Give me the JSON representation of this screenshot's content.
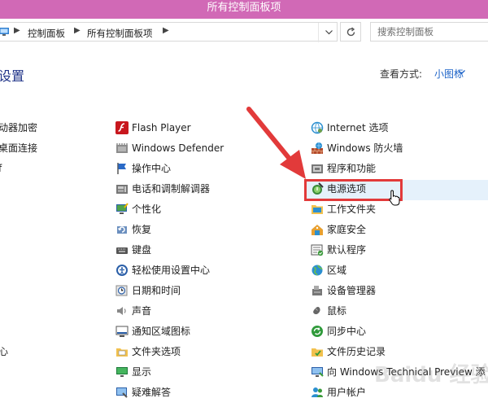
{
  "window": {
    "title": "所有控制面板项"
  },
  "address": {
    "crumbs": [
      "控制面板",
      "所有控制面板项"
    ],
    "search_placeholder": "搜索控制面板"
  },
  "heading": "设置",
  "view": {
    "label": "查看方式:",
    "mode": "小图标"
  },
  "col1": [
    {
      "label": "动器加密"
    },
    {
      "label": "桌面连接"
    },
    {
      "label": "f"
    },
    {
      "label": "心"
    }
  ],
  "col2": [
    {
      "label": "Flash Player",
      "icon": "flash-icon"
    },
    {
      "label": "Windows Defender",
      "icon": "defender-icon"
    },
    {
      "label": "操作中心",
      "icon": "flag-icon"
    },
    {
      "label": "电话和调制解调器",
      "icon": "phone-modem-icon"
    },
    {
      "label": "个性化",
      "icon": "personalization-icon"
    },
    {
      "label": "恢复",
      "icon": "recovery-icon"
    },
    {
      "label": "键盘",
      "icon": "keyboard-icon"
    },
    {
      "label": "轻松使用设置中心",
      "icon": "ease-of-access-icon"
    },
    {
      "label": "日期和时间",
      "icon": "clock-icon"
    },
    {
      "label": "声音",
      "icon": "speaker-icon"
    },
    {
      "label": "通知区域图标",
      "icon": "notification-icon"
    },
    {
      "label": "文件夹选项",
      "icon": "folder-options-icon"
    },
    {
      "label": "显示",
      "icon": "display-icon"
    },
    {
      "label": "疑难解答",
      "icon": "troubleshoot-icon"
    }
  ],
  "col3": [
    {
      "label": "Internet 选项",
      "icon": "internet-options-icon"
    },
    {
      "label": "Windows 防火墙",
      "icon": "firewall-icon"
    },
    {
      "label": "程序和功能",
      "icon": "programs-icon"
    },
    {
      "label": "电源选项",
      "icon": "power-options-icon"
    },
    {
      "label": "工作文件夹",
      "icon": "work-folders-icon"
    },
    {
      "label": "家庭安全",
      "icon": "family-safety-icon"
    },
    {
      "label": "默认程序",
      "icon": "default-programs-icon"
    },
    {
      "label": "区域",
      "icon": "region-icon"
    },
    {
      "label": "设备管理器",
      "icon": "device-manager-icon"
    },
    {
      "label": "鼠标",
      "icon": "mouse-icon"
    },
    {
      "label": "同步中心",
      "icon": "sync-center-icon"
    },
    {
      "label": "文件历史记录",
      "icon": "file-history-icon"
    },
    {
      "label": "向 Windows Technical Preview 添",
      "icon": "add-features-icon"
    },
    {
      "label": "用户帐户",
      "icon": "user-accounts-icon"
    }
  ],
  "watermark": "Baidu 经验",
  "colors": {
    "titlebar": "#d169b6",
    "link": "#1e64c8",
    "heading": "#1e3287",
    "highlight": "#e23a3a"
  }
}
